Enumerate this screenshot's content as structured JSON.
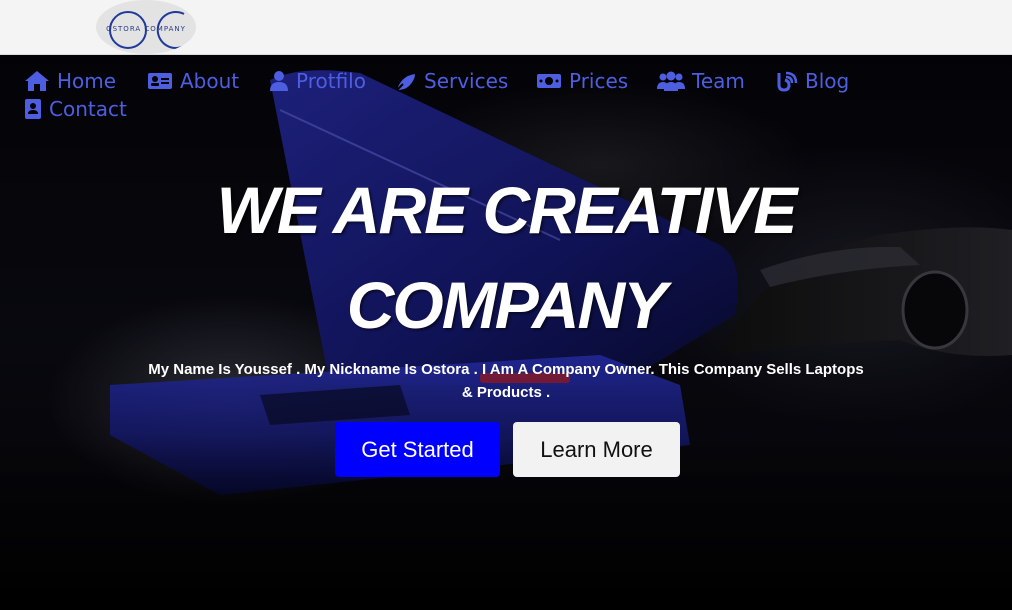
{
  "brand": {
    "logo_text": "OSTORA COMPANY"
  },
  "nav": {
    "items": [
      {
        "label": "Home",
        "icon": "home-icon"
      },
      {
        "label": "About",
        "icon": "id-card-icon"
      },
      {
        "label": "Protfilo",
        "icon": "user-icon"
      },
      {
        "label": "Services",
        "icon": "rocket-icon"
      },
      {
        "label": "Prices",
        "icon": "money-icon"
      },
      {
        "label": "Team",
        "icon": "users-icon"
      },
      {
        "label": "Blog",
        "icon": "blog-icon"
      },
      {
        "label": "Contact",
        "icon": "contact-card-icon"
      }
    ]
  },
  "hero": {
    "title_line1": "WE ARE CREATIVE",
    "title_line2": "COMPANY",
    "description": "My Name Is Youssef . My Nickname Is Ostora . I Am A Company Owner. This Company Sells Laptops & Products .",
    "primary_button": "Get Started",
    "secondary_button": "Learn More"
  },
  "colors": {
    "nav_link": "#4d5fe0",
    "primary_button": "#0000ff",
    "topbar": "#f4f4f4"
  }
}
